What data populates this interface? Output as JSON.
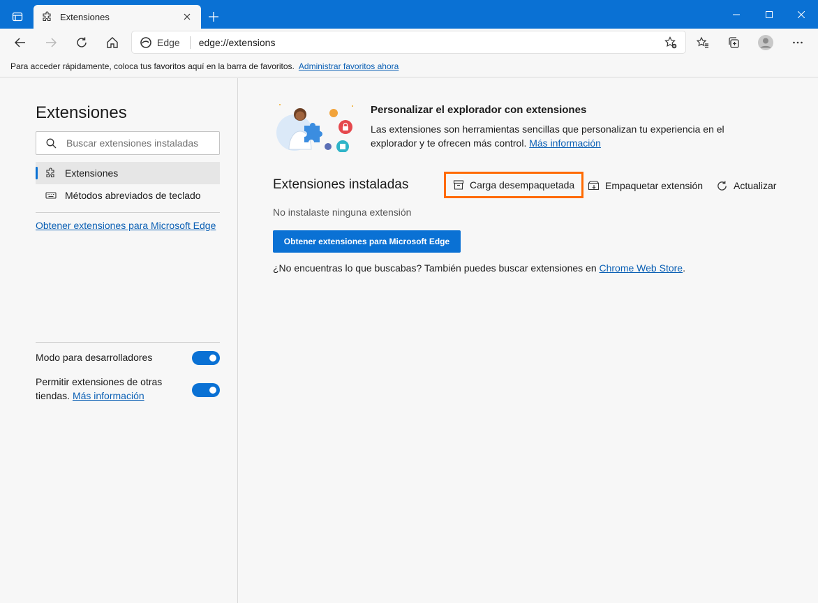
{
  "window": {
    "tab_title": "Extensiones",
    "accent": "#0a71d4"
  },
  "toolbar": {
    "site_label": "Edge",
    "url": "edge://extensions"
  },
  "favorites_bar": {
    "message": "Para acceder rápidamente, coloca tus favoritos aquí en la barra de favoritos.",
    "link": "Administrar favoritos ahora"
  },
  "sidebar": {
    "title": "Extensiones",
    "search_placeholder": "Buscar extensiones instaladas",
    "items": [
      {
        "label": "Extensiones",
        "icon": "puzzle-icon",
        "active": true
      },
      {
        "label": "Métodos abreviados de teclado",
        "icon": "keyboard-icon",
        "active": false
      }
    ],
    "get_link": "Obtener extensiones para Microsoft Edge",
    "developer_mode": {
      "label": "Modo para desarrolladores",
      "on": true
    },
    "other_stores": {
      "label": "Permitir extensiones de otras tiendas.",
      "link": "Más información",
      "on": true
    }
  },
  "main": {
    "hero": {
      "title": "Personalizar el explorador con extensiones",
      "text": "Las extensiones son herramientas sencillas que personalizan tu experiencia en el explorador y te ofrecen más control.",
      "link": "Más información"
    },
    "installed_title": "Extensiones instaladas",
    "actions": {
      "load_unpacked": "Carga desempaquetada",
      "pack": "Empaquetar extensión",
      "refresh": "Actualizar"
    },
    "empty_message": "No instalaste ninguna extensión",
    "get_button": "Obtener extensiones para Microsoft Edge",
    "store_text": "¿No encuentras lo que buscabas? También puedes buscar extensiones en",
    "store_link": "Chrome Web Store",
    "store_end": "."
  },
  "colors": {
    "highlight": "#ff6a00",
    "link": "#0a5fb4"
  }
}
